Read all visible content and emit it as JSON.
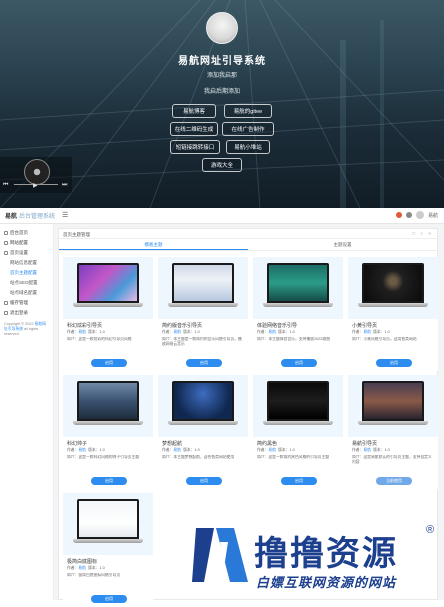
{
  "hero": {
    "title": "易航网址引导系统",
    "lines": [
      "添加我启那",
      "我启后期添加"
    ],
    "buttons": [
      {
        "label": "易航博客"
      },
      {
        "label": "易航的gitee"
      },
      {
        "label": "在线二维码生成"
      },
      {
        "label": "在线广告制作"
      },
      {
        "label": "短链接跳转接口"
      },
      {
        "label": "易航小堆站"
      },
      {
        "label": "游戏大全"
      }
    ],
    "player": {
      "prev": "⏮",
      "play": "▶",
      "next": "⏭"
    }
  },
  "admin": {
    "logo_main": "易航",
    "logo_sub": "后台管理系统",
    "menu_icon": "☰",
    "user_label": "易航",
    "sidebar": [
      {
        "label": "后台首页",
        "sub": false,
        "active": false
      },
      {
        "label": "网站配置",
        "sub": false,
        "active": false
      },
      {
        "label": "首页设置",
        "sub": false,
        "active": false
      },
      {
        "label": "网站信息配置",
        "sub": true,
        "active": false
      },
      {
        "label": "首页主题配置",
        "sub": true,
        "active": true
      },
      {
        "label": "站点SEO配置",
        "sub": true,
        "active": false
      },
      {
        "label": "站点域名配置",
        "sub": true,
        "active": false
      },
      {
        "label": "缓存管理",
        "sub": false,
        "active": false
      },
      {
        "label": "退出登录",
        "sub": false,
        "active": false
      }
    ],
    "copyright": {
      "prefix": "Copyright © 2022",
      "link": "易航网址引导系统",
      "suffix": "all rights reserved"
    },
    "panel_title": "首页主题管理",
    "panel_tools": "□ ○ ×",
    "tabs": [
      "模板主题",
      "主题设置"
    ],
    "meta": {
      "author_label": "作者：",
      "author": "易航",
      "version_label": "版本：",
      "version": "1.0"
    },
    "cards": [
      {
        "title": "科幻炫彩引导页",
        "desc": "简介：这是一款炫彩的科幻引导页风格",
        "button": "启用",
        "current": false
      },
      {
        "title": "简约版音乐引导页",
        "desc": "简介：本主题是一款简约的音乐风格引导页，播放网易云音乐",
        "button": "启用",
        "current": false
      },
      {
        "title": "体验网络音乐引导",
        "desc": "简介：本主题体验音乐，支持播放2022歌曲",
        "button": "启用",
        "current": false
      },
      {
        "title": "小黄引导页",
        "desc": "简介：小黄风格引导页，适用各类网站",
        "button": "启用",
        "current": false
      },
      {
        "title": "科幻帅子",
        "desc": "简介：这是一款科幻风格的帅子引导页主题",
        "button": "启用",
        "current": false
      },
      {
        "title": "梦想起航",
        "desc": "简介：本主题梦想起航，适合各类网站使用",
        "button": "启用",
        "current": false
      },
      {
        "title": "简约黑色",
        "desc": "简介：这是一款简约黑色风格的引导页主题",
        "button": "启用",
        "current": false
      },
      {
        "title": "易航引导页",
        "desc": "简介：这是易航默认的引导页主题，支持自定义内容",
        "button": "当前使用",
        "current": true
      },
      {
        "title": "极简白底图标",
        "desc": "简介：极简白底图标风格引导页",
        "button": "启用",
        "current": false
      }
    ]
  },
  "watermark": {
    "brand": "撸撸资源",
    "reg": "®",
    "slogan": "白嫖互联网资源的网站"
  },
  "colors": {
    "accent": "#2d8cf0",
    "brand": "#1c3f8e"
  }
}
